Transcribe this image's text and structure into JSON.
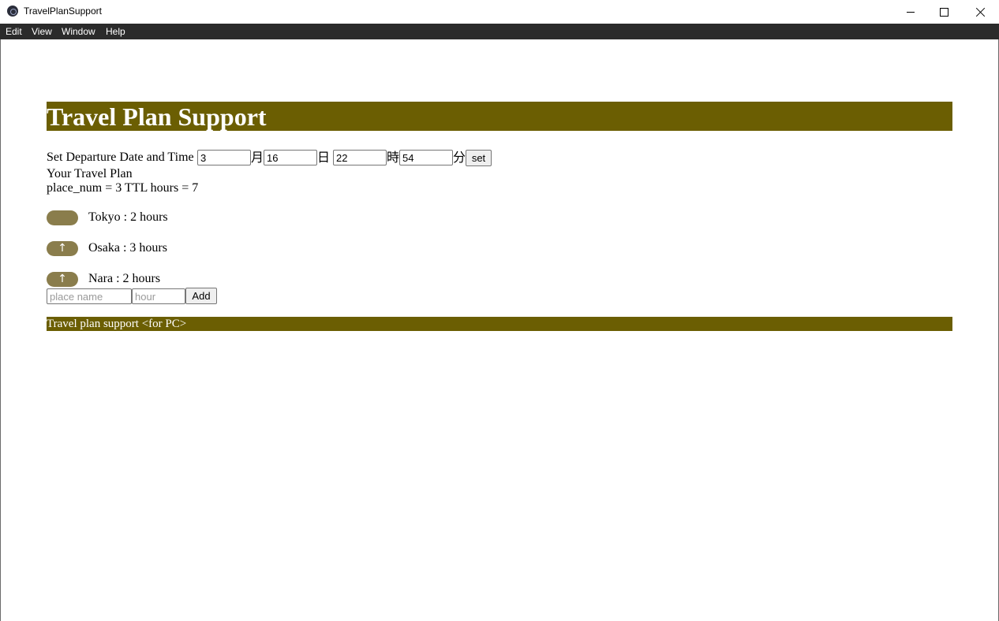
{
  "window": {
    "title": "TravelPlanSupport",
    "icon": "app-icon"
  },
  "menu": {
    "items": [
      "Edit",
      "View",
      "Window",
      "Help"
    ]
  },
  "header": {
    "title": "Travel Plan Support"
  },
  "departure": {
    "label": "Set Departure Date and Time",
    "month_value": "3",
    "month_unit": "月",
    "day_value": "16",
    "day_unit": "日",
    "hour_value": "22",
    "hour_unit": "時",
    "minute_value": "54",
    "minute_unit": "分",
    "set_label": "set"
  },
  "plan": {
    "heading": "Your Travel Plan",
    "summary": "place_num = 3 TTL hours = 7",
    "places": [
      {
        "text": "Tokyo : 2 hours",
        "button": ""
      },
      {
        "text": "Osaka : 3 hours",
        "button": "↑"
      },
      {
        "text": "Nara : 2 hours",
        "button": "↑"
      }
    ]
  },
  "add_form": {
    "place_placeholder": "place name",
    "hour_placeholder": "hour",
    "add_label": "Add"
  },
  "footer": {
    "text": "Travel plan support <for PC>"
  },
  "colors": {
    "accent": "#6b5e02",
    "pill": "#8a7d4c",
    "menubar": "#2b2b2b"
  }
}
